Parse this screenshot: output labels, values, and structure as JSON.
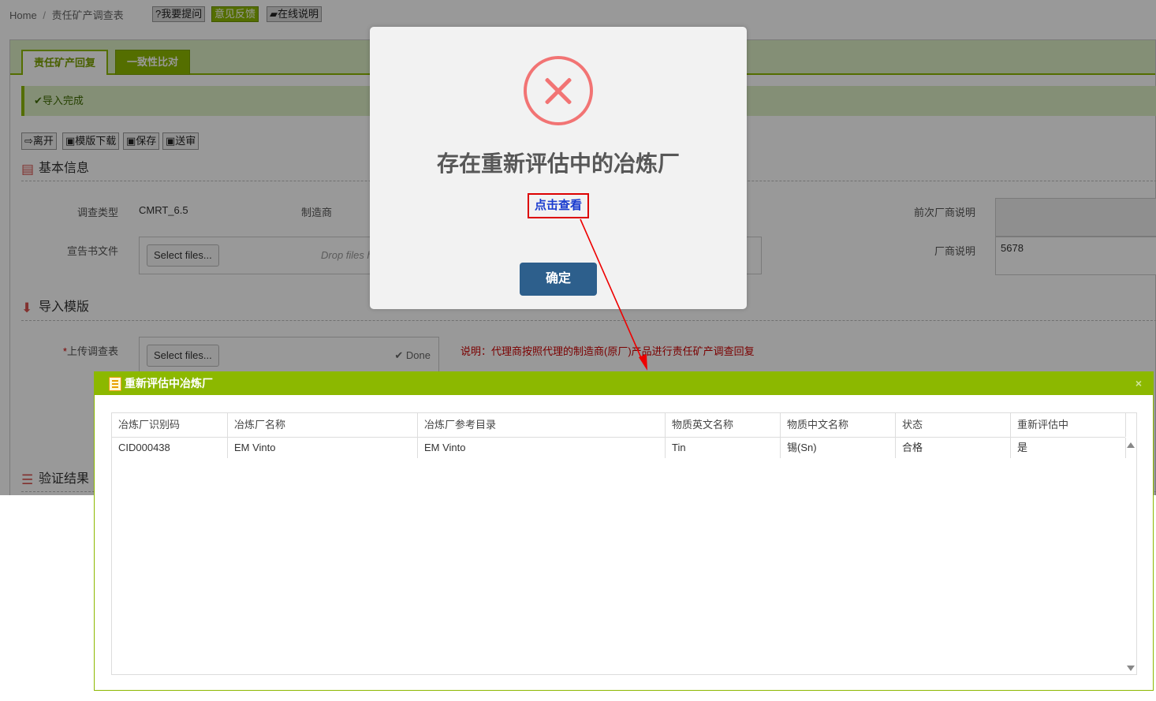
{
  "breadcrumb": {
    "home": "Home",
    "separator": "/",
    "current": "责任矿产调查表"
  },
  "topbar": {
    "ask": "?我要提问",
    "feedback": "意见反馈",
    "help": "在线说明"
  },
  "tabs": [
    {
      "label": "责任矿产回复"
    },
    {
      "label": "一致性比对"
    }
  ],
  "success_message": "导入完成",
  "toolbar": {
    "leave": "离开",
    "template_download": "模版下载",
    "save": "保存",
    "submit": "送审"
  },
  "sections": {
    "basic_info": "基本信息",
    "import_template": "导入模版",
    "validation": "验证结果"
  },
  "form": {
    "survey_type_label": "调查类型",
    "survey_type_value": "CMRT_6.5",
    "manufacturer_label": "制造商",
    "prev_vendor_note_label": "前次厂商说明",
    "declaration_label": "宣告书文件",
    "vendor_note_label": "厂商说明",
    "vendor_note_value": "5678",
    "select_files": "Select files...",
    "drop_files": "Drop files h",
    "upload_required": "*",
    "upload_label": "上传调查表",
    "done": "Done",
    "note": "说明：代理商按照代理的制造商(原厂)产品进行责任矿产调查回复"
  },
  "alert": {
    "title": "存在重新评估中的冶炼厂",
    "link": "点击查看",
    "ok": "确定"
  },
  "window": {
    "title": "重新评估中冶炼厂",
    "close": "×",
    "columns": [
      "冶炼厂识别码",
      "冶炼厂名称",
      "冶炼厂参考目录",
      "物质英文名称",
      "物质中文名称",
      "状态",
      "重新评估中"
    ],
    "rows": [
      [
        "CID000438",
        "EM Vinto",
        "EM Vinto",
        "Tin",
        "锡(Sn)",
        "合格",
        "是"
      ]
    ]
  },
  "colors": {
    "accent_green": "#8cb800",
    "error_red": "#f27474",
    "button_blue": "#2d5f8c"
  }
}
